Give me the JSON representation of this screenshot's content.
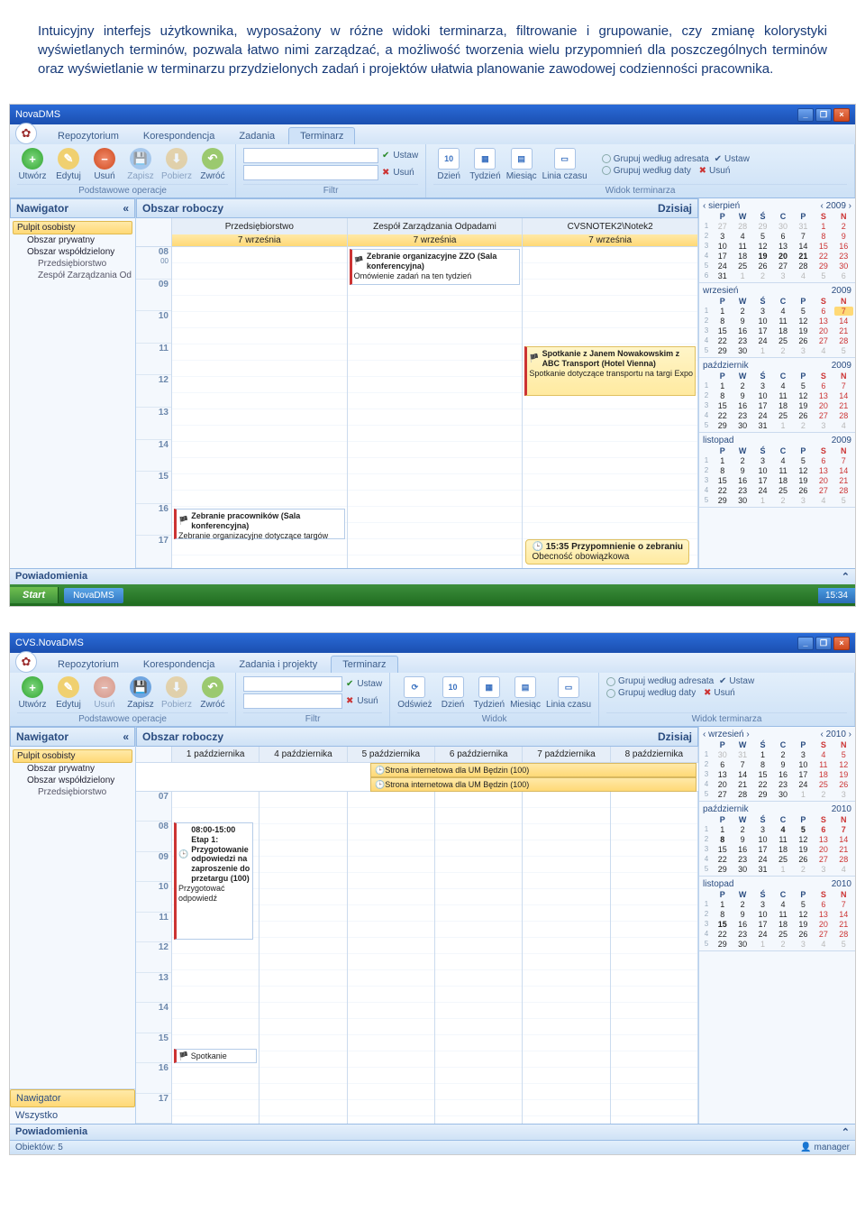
{
  "para": "Intuicyjny interfejs użytkownika, wyposażony w różne widoki terminarza, filtrowanie i grupowanie, czy zmianę kolorystyki wyświetlanych terminów, pozwala łatwo nimi zarządzać, a możliwość tworzenia wielu przypomnień dla poszczególnych terminów oraz wyświetlanie w terminarzu przydzielonych zadań i projektów ułatwia planowanie zawodowej codzienności pracownika.",
  "shot1": {
    "title": "NovaDMS",
    "tabs": [
      "Repozytorium",
      "Korespondencja",
      "Zadania",
      "Terminarz"
    ],
    "rgroups": {
      "ops": {
        "label": "Podstawowe operacje",
        "btns": [
          "Utwórz",
          "Edytuj",
          "Usuń",
          "Zapisz",
          "Pobierz",
          "Zwróć"
        ]
      },
      "filter": {
        "label": "Filtr",
        "set": "Ustaw",
        "del": "Usuń"
      },
      "view": {
        "label": "Widok terminarza",
        "btns": [
          "Dzień",
          "Tydzień",
          "Miesiąc",
          "Linia czasu"
        ],
        "g1": "Grupuj według adresata",
        "g2": "Grupuj według daty",
        "set": "Ustaw",
        "del": "Usuń"
      }
    },
    "nav": {
      "title": "Nawigator",
      "root": "Pulpit osobisty",
      "lvl1": [
        "Obszar prywatny",
        "Obszar współdzielony"
      ],
      "lvl2": [
        "Przedsiębiorstwo",
        "Zespół Zarządzania Od"
      ]
    },
    "work": {
      "title": "Obszar roboczy",
      "today": "Dzisiaj",
      "cols": [
        "Przedsiębiorstwo",
        "Zespół Zarządzania Odpadami",
        "CVSNOTEK2\\Notek2"
      ],
      "date": "7 września",
      "hours": [
        "08",
        "09",
        "10",
        "11",
        "12",
        "13",
        "14",
        "15",
        "16",
        "17"
      ],
      "evt1": {
        "title": "Zebranie organizacyjne ZZO (Sala konferencyjna)",
        "desc": "Omówienie zadań na ten tydzień"
      },
      "evt2": {
        "title": "Spotkanie z Janem Nowakowskim z ABC Transport (Hotel Vienna)",
        "desc": "Spotkanie dotyczące transportu na targi Expo"
      },
      "evt3": {
        "title": "Zebranie pracowników (Sala konferencyjna)",
        "desc": "Zebranie organizacyjne dotyczące targów"
      },
      "reminder": {
        "time": "15:35",
        "title": "Przypomnienie o zebraniu",
        "desc": "Obecność obowiązkowa"
      }
    },
    "cal": {
      "m1": {
        "name": "sierpień",
        "year": "2009"
      },
      "m2": {
        "name": "wrzesień",
        "year": "2009"
      },
      "m3": {
        "name": "październik",
        "year": "2009"
      },
      "m4": {
        "name": "listopad",
        "year": "2009"
      }
    },
    "pow": "Powiadomienia",
    "taskbar": {
      "start": "Start",
      "app": "NovaDMS",
      "clock": "15:34"
    }
  },
  "shot2": {
    "title": "CVS.NovaDMS",
    "tabs": [
      "Repozytorium",
      "Korespondencja",
      "Zadania i projekty",
      "Terminarz"
    ],
    "rgroups": {
      "ops": {
        "label": "Podstawowe operacje",
        "btns": [
          "Utwórz",
          "Edytuj",
          "Usuń",
          "Zapisz",
          "Pobierz",
          "Zwróć"
        ]
      },
      "filter": {
        "label": "Filtr",
        "set": "Ustaw",
        "del": "Usuń"
      },
      "widok": {
        "label": "Widok",
        "btns": [
          "Odśwież",
          "Dzień",
          "Tydzień",
          "Miesiąc",
          "Linia czasu"
        ]
      },
      "view": {
        "label": "Widok terminarza",
        "g1": "Grupuj według adresata",
        "g2": "Grupuj według daty",
        "set": "Ustaw",
        "del": "Usuń"
      }
    },
    "nav": {
      "title": "Nawigator",
      "root": "Pulpit osobisty",
      "lvl1": [
        "Obszar prywatny",
        "Obszar współdzielony"
      ],
      "lvl2": [
        "Przedsiębiorstwo"
      ],
      "btm": [
        "Nawigator",
        "Wszystko"
      ]
    },
    "work": {
      "title": "Obszar roboczy",
      "today": "Dzisiaj",
      "cols": [
        "1 października",
        "4 października",
        "5 października",
        "6 października",
        "7 października",
        "8 października"
      ],
      "hours": [
        "07",
        "08",
        "09",
        "10",
        "11",
        "12",
        "13",
        "14",
        "15",
        "16",
        "17"
      ],
      "allday1": "Strona internetowa dla UM Będzin (100)",
      "allday2": "Strona internetowa dla UM Będzin (100)",
      "evt1": {
        "title": "08:00-15:00 Etap 1: Przygotowanie odpowiedzi na zaproszenie do przetargu (100)",
        "desc": "Przygotować odpowiedź"
      },
      "evt2": "Spotkanie"
    },
    "cal": {
      "m1": {
        "name": "wrzesień",
        "year": "2010"
      },
      "m2": {
        "name": "październik",
        "year": "2010"
      },
      "m3": {
        "name": "listopad",
        "year": "2010"
      }
    },
    "pow": "Powiadomienia",
    "status": {
      "obj": "Obiektów:  5",
      "user": "manager"
    }
  },
  "dow": [
    "P",
    "W",
    "Ś",
    "C",
    "P",
    "S",
    "N"
  ]
}
